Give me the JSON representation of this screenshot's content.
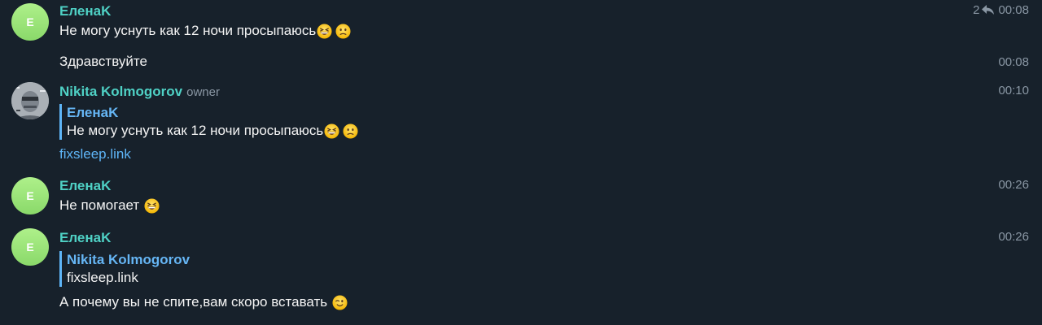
{
  "messages": [
    {
      "author": "ЕленаK",
      "avatar_letter": "E",
      "text": "Не могу уснуть как 12 ночи просыпаюсь",
      "emojis": [
        "grinning-squinting-emoji",
        "confused-emoji"
      ],
      "reply_count": "2",
      "time": "00:08"
    },
    {
      "text": "Здравствуйте",
      "time": "00:08"
    },
    {
      "author": "Nikita Kolmogorov",
      "role": "owner",
      "quote": {
        "author": "ЕленаK",
        "text": "Не могу уснуть как 12 ночи просыпаюсь",
        "emojis": [
          "grinning-squinting-emoji",
          "confused-emoji"
        ]
      },
      "link": "fixsleep.link",
      "time": "00:10"
    },
    {
      "author": "ЕленаK",
      "avatar_letter": "E",
      "text": "Не помогает",
      "emojis": [
        "grinning-squinting-emoji"
      ],
      "time": "00:26"
    },
    {
      "author": "ЕленаK",
      "avatar_letter": "E",
      "quote": {
        "author": "Nikita Kolmogorov",
        "text": "fixsleep.link"
      },
      "text": "А почему вы не спите,вам скоро вставать",
      "emojis": [
        "winking-emoji"
      ],
      "time": "00:26"
    }
  ],
  "colors": {
    "background": "#17212b",
    "author_name": "#4fd1c5",
    "link": "#5eb5f7",
    "quote_bar": "#5eb5f7",
    "timestamp": "#8a97a4"
  }
}
